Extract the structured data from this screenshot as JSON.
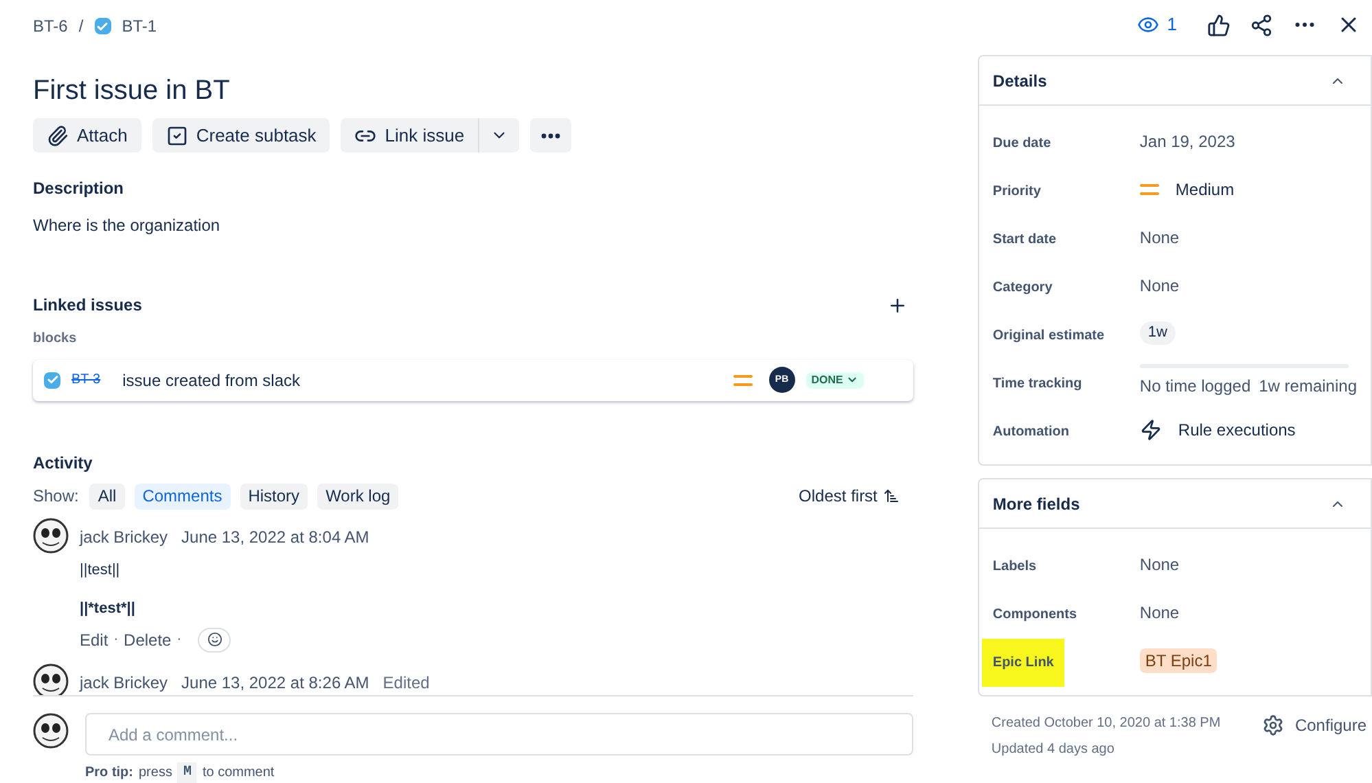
{
  "breadcrumbs": {
    "parent": "BT-6",
    "separator": "/",
    "issue_key": "BT-1"
  },
  "top_actions": {
    "watchers": "1"
  },
  "title": "First issue in BT",
  "toolbar": [
    {
      "kind": "attach",
      "label": "Attach"
    },
    {
      "kind": "subtask",
      "label": "Create subtask"
    },
    {
      "kind": "link",
      "label": "Link issue"
    }
  ],
  "description": {
    "heading": "Description",
    "text": "Where is the organization"
  },
  "linked_issues": {
    "heading": "Linked issues",
    "relation": "blocks",
    "items": [
      {
        "key": "BT-3",
        "summary": "issue created from slack",
        "done": true,
        "assignee": "PB",
        "status": "DONE"
      }
    ]
  },
  "activity": {
    "heading": "Activity",
    "show_label": "Show:",
    "filters": [
      {
        "label": "All",
        "selected": false
      },
      {
        "label": "Comments",
        "selected": true
      },
      {
        "label": "History",
        "selected": false
      },
      {
        "label": "Work log",
        "selected": false
      }
    ],
    "sort": "Oldest first",
    "comments": [
      {
        "author": "jack Brickey",
        "time": "June 13, 2022 at 8:04 AM",
        "lines": [
          {
            "text": "||test||",
            "bold": false
          },
          {
            "text": "||*test*||",
            "bold": true
          }
        ],
        "actions": [
          "Edit",
          "Delete"
        ],
        "separator": "·"
      },
      {
        "author": "jack Brickey",
        "time": "June 13, 2022 at 8:26 AM",
        "edited_label": "Edited"
      }
    ],
    "comment_box": {
      "placeholder": "Add a comment..."
    },
    "pro_tip": {
      "label": "Pro tip:",
      "before": "press",
      "key": "M",
      "after": "to comment"
    }
  },
  "details": {
    "heading": "Details",
    "expanded": true,
    "fields": [
      {
        "label": "Due date",
        "kind": "text",
        "value": "Jan 19, 2023"
      },
      {
        "label": "Priority",
        "kind": "priority",
        "value": "Medium"
      },
      {
        "label": "Start date",
        "kind": "text",
        "value": "None"
      },
      {
        "label": "Category",
        "kind": "text",
        "value": "None"
      },
      {
        "label": "Original estimate",
        "kind": "tag",
        "value": "1w"
      },
      {
        "label": "Time tracking",
        "kind": "tracking",
        "value": "No time logged",
        "remaining": "1w remaining"
      },
      {
        "label": "Automation",
        "kind": "automation",
        "value": "Rule executions"
      }
    ]
  },
  "more_fields": {
    "heading": "More fields",
    "expanded": true,
    "fields": [
      {
        "label": "Labels",
        "kind": "text",
        "value": "None",
        "highlighted": false
      },
      {
        "label": "Components",
        "kind": "text",
        "value": "None",
        "highlighted": false
      },
      {
        "label": "Epic Link",
        "kind": "epic",
        "value": "BT Epic1",
        "highlighted": true
      }
    ]
  },
  "footer": {
    "created": "Created October 10, 2020 at 1:38 PM",
    "updated": "Updated 4 days ago",
    "configure": "Configure"
  }
}
